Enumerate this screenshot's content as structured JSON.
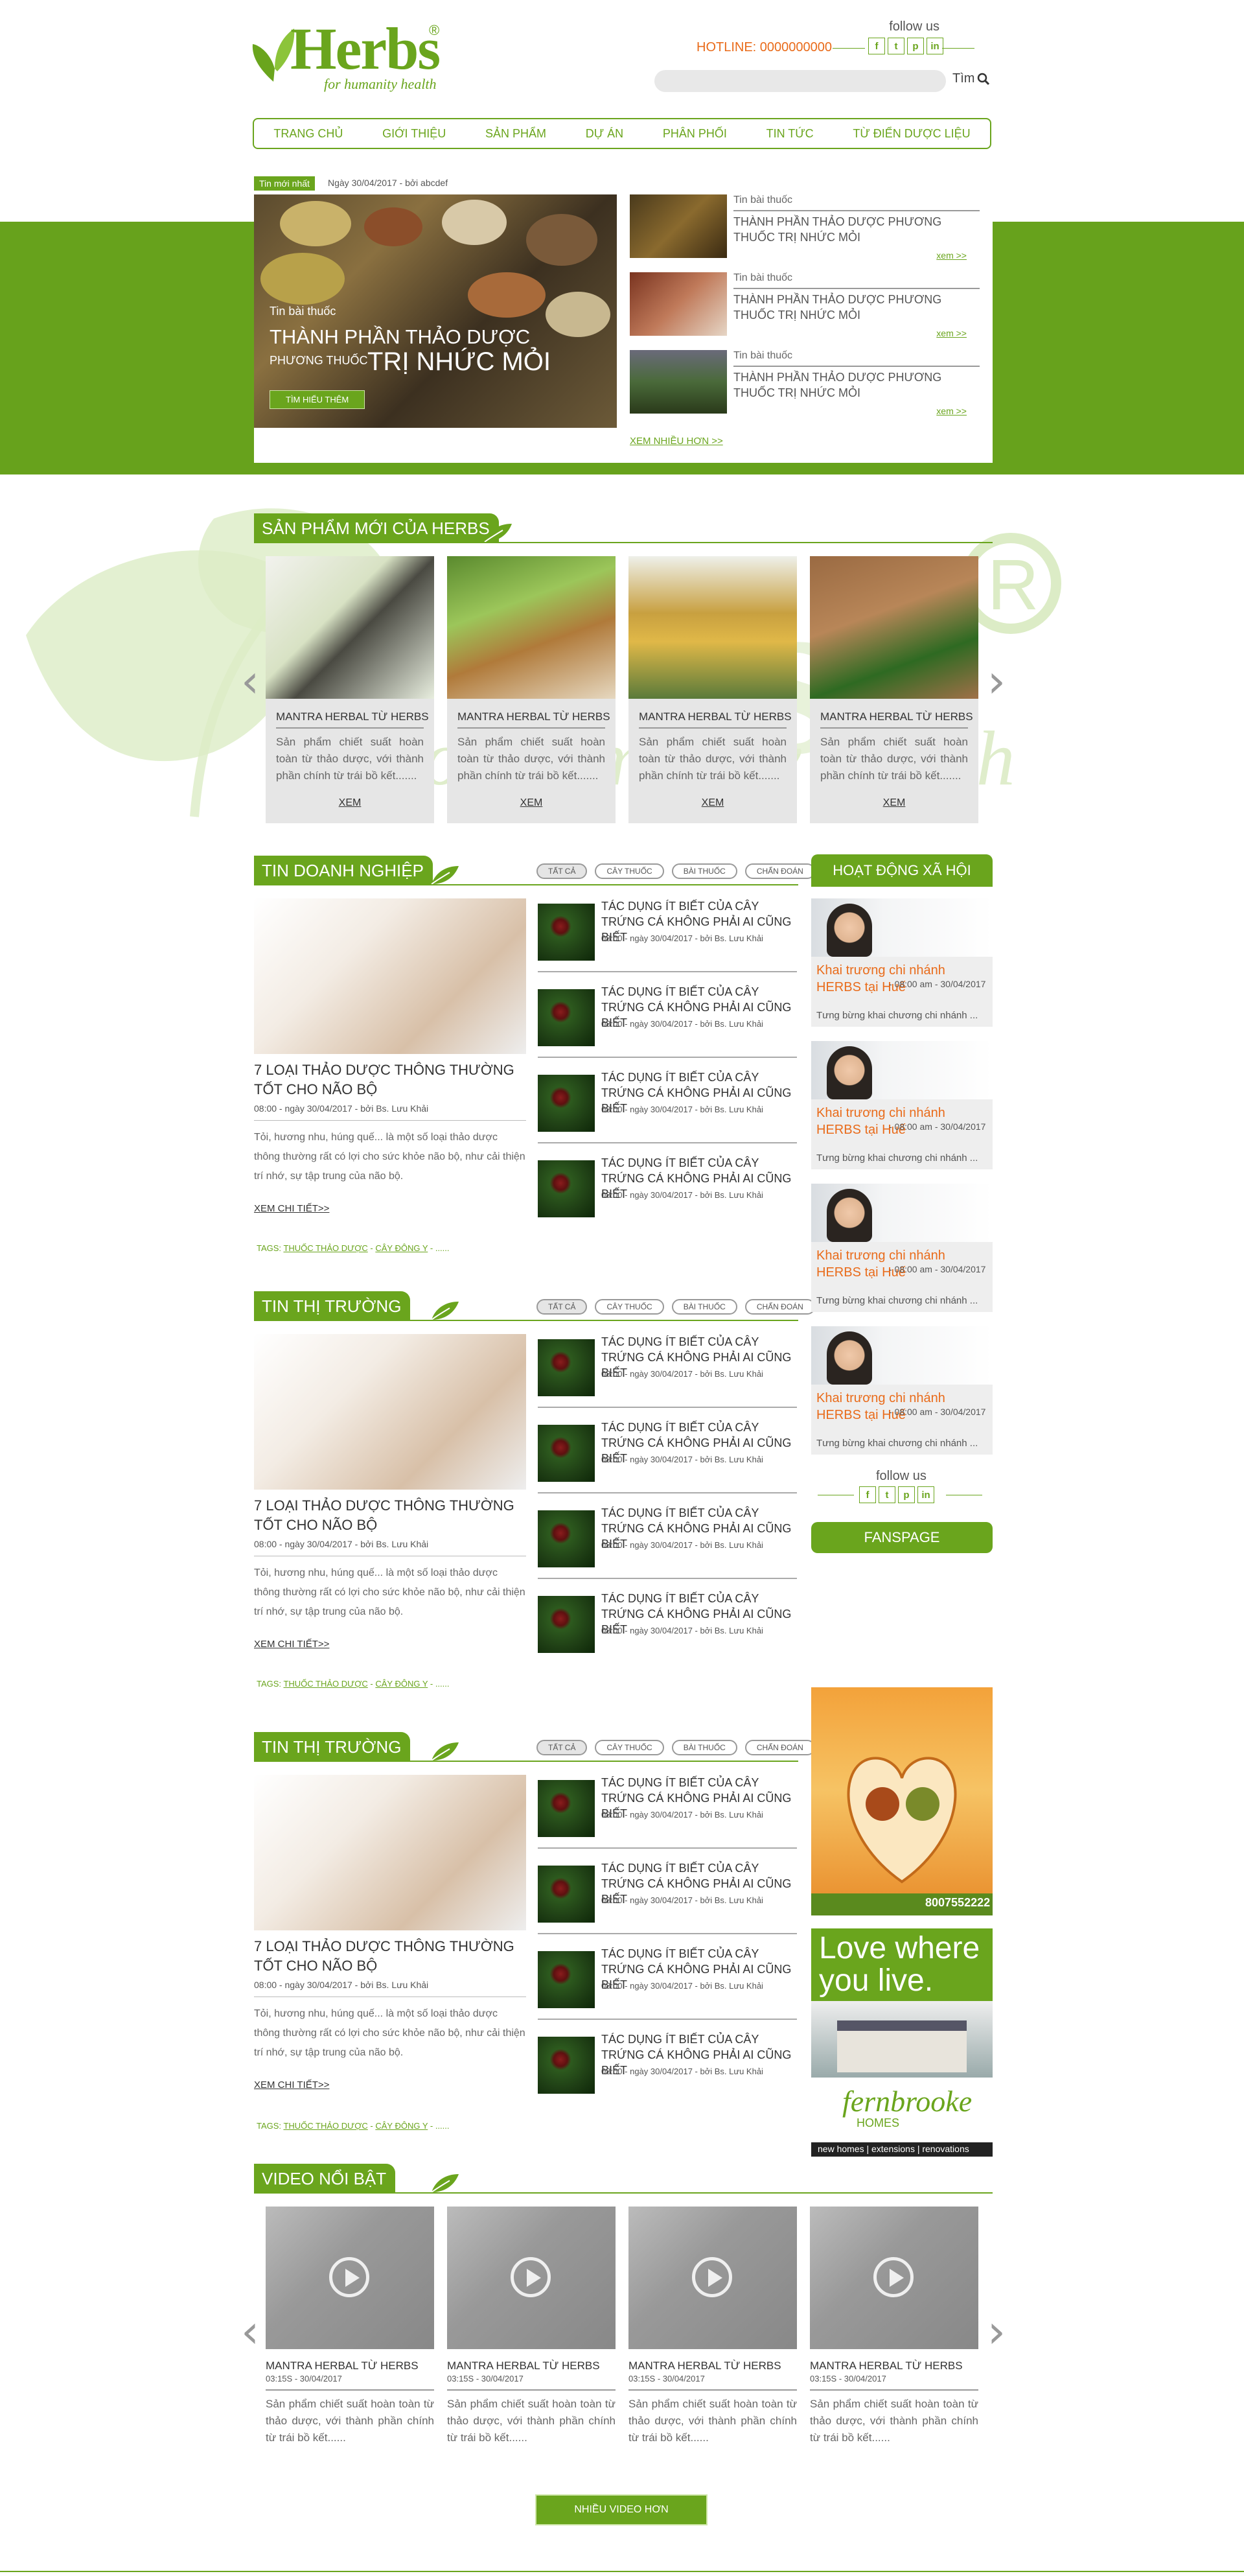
{
  "header": {
    "logo_text": "Herbs",
    "logo_tagline": "for humanity health",
    "logo_reg": "®",
    "follow_us": "follow us",
    "hotline": "HOTLINE: 0000000000",
    "search_placeholder": "",
    "search_button": "Tìm",
    "social": [
      "f",
      "t",
      "p",
      "in"
    ]
  },
  "nav": [
    "TRANG CHỦ",
    "GIỚI THIỆU",
    "SẢN PHẨM",
    "DỰ ÁN",
    "PHÂN PHỐI",
    "TIN TỨC",
    "TỪ ĐIỂN DƯỢC LIỆU"
  ],
  "hero": {
    "badge": "Tin mới nhất",
    "date": "Ngày 30/04/2017 - bởi abcdef",
    "category": "Tin bài thuốc",
    "title": "THÀNH PHẦN THẢO DƯỢC",
    "subtitle_small": "PHƯƠNG THUỐC",
    "subtitle_big": "TRỊ NHỨC MỎI",
    "button": "TÌM HIỂU THÊM",
    "side_news": [
      {
        "category": "Tin bài thuốc",
        "title": "THÀNH PHẦN THẢO DƯỢC PHƯƠNG THUỐC TRỊ NHỨC MỎI",
        "more": "xem >>"
      },
      {
        "category": "Tin bài thuốc",
        "title": "THÀNH PHẦN THẢO DƯỢC PHƯƠNG THUỐC TRỊ NHỨC MỎI",
        "more": "xem >>"
      },
      {
        "category": "Tin bài thuốc",
        "title": "THÀNH PHẦN THẢO DƯỢC PHƯƠNG THUỐC TRỊ NHỨC MỎI",
        "more": "xem >>"
      }
    ],
    "more_news": "XEM NHIỀU HƠN >>"
  },
  "products": {
    "heading": "SẢN PHẨM MỚI CỦA HERBS",
    "items": [
      {
        "title": "MANTRA HERBAL TỪ HERBS",
        "desc": "Sản phẩm chiết suất hoàn toàn từ thảo dược, với thành phần chính từ trái bồ kết.......",
        "more": "XEM"
      },
      {
        "title": "MANTRA HERBAL TỪ HERBS",
        "desc": "Sản phẩm chiết suất hoàn toàn từ thảo dược, với thành phần chính từ trái bồ kết.......",
        "more": "XEM"
      },
      {
        "title": "MANTRA HERBAL TỪ HERBS",
        "desc": "Sản phẩm chiết suất hoàn toàn từ thảo dược, với thành phần chính từ trái bồ kết.......",
        "more": "XEM"
      },
      {
        "title": "MANTRA HERBAL TỪ HERBS",
        "desc": "Sản phẩm chiết suất hoàn toàn từ thảo dược, với thành phần chính từ trái bồ kết.......",
        "more": "XEM"
      }
    ]
  },
  "filters": [
    "TẤT CẢ",
    "CÂY THUỐC",
    "BÀI THUỐC",
    "CHẨN ĐOÁN"
  ],
  "news_sections": [
    {
      "heading": "TIN DOANH NGHIỆP",
      "big_title": "7 LOẠI THẢO DƯỢC THÔNG THƯỜNG TỐT CHO NÃO BỘ",
      "big_meta": "08:00 - ngày 30/04/2017 - bởi Bs. Lưu Khải",
      "big_desc": "Tỏi, hương nhu, húng quế... là một số loại thảo dược thông thường rất có lợi cho sức khỏe não bộ, như cải thiện trí nhớ, sự tập trung của não bộ.",
      "big_more": "XEM CHI TIẾT>>",
      "tags_label": "TAGS:",
      "tag1": "THUỐC THẢO DƯỢC",
      "tag2": "CÂY ĐÔNG Y",
      "tags_end": "- ......",
      "items": [
        {
          "title": "TÁC DỤNG ÍT BIẾT CỦA CÂY TRỨNG CÁ KHÔNG PHẢI AI CŨNG BIẾT",
          "meta": "08:00 - ngày 30/04/2017 - bởi Bs. Lưu Khải"
        },
        {
          "title": "TÁC DỤNG ÍT BIẾT CỦA CÂY TRỨNG CÁ KHÔNG PHẢI AI CŨNG BIẾT",
          "meta": "08:00 - ngày 30/04/2017 - bởi Bs. Lưu Khải"
        },
        {
          "title": "TÁC DỤNG ÍT BIẾT CỦA CÂY TRỨNG CÁ KHÔNG PHẢI AI CŨNG BIẾT",
          "meta": "08:00 - ngày 30/04/2017 - bởi Bs. Lưu Khải"
        },
        {
          "title": "TÁC DỤNG ÍT BIẾT CỦA CÂY TRỨNG CÁ KHÔNG PHẢI AI CŨNG BIẾT",
          "meta": "08:00 - ngày 30/04/2017 - bởi Bs. Lưu Khải"
        }
      ]
    },
    {
      "heading": "TIN THỊ TRƯỜNG",
      "big_title": "7 LOẠI THẢO DƯỢC THÔNG THƯỜNG TỐT CHO NÃO BỘ",
      "big_meta": "08:00 - ngày 30/04/2017 - bởi Bs. Lưu Khải",
      "big_desc": "Tỏi, hương nhu, húng quế... là một số loại thảo dược thông thường rất có lợi cho sức khỏe não bộ, như cải thiện trí nhớ, sự tập trung của não bộ.",
      "big_more": "XEM CHI TIẾT>>",
      "tags_label": "TAGS:",
      "tag1": "THUỐC THẢO DƯỢC",
      "tag2": "CÂY ĐÔNG Y",
      "tags_end": "- ......",
      "items": [
        {
          "title": "TÁC DỤNG ÍT BIẾT CỦA CÂY TRỨNG CÁ KHÔNG PHẢI AI CŨNG BIẾT",
          "meta": "08:00 - ngày 30/04/2017 - bởi Bs. Lưu Khải"
        },
        {
          "title": "TÁC DỤNG ÍT BIẾT CỦA CÂY TRỨNG CÁ KHÔNG PHẢI AI CŨNG BIẾT",
          "meta": "08:00 - ngày 30/04/2017 - bởi Bs. Lưu Khải"
        },
        {
          "title": "TÁC DỤNG ÍT BIẾT CỦA CÂY TRỨNG CÁ KHÔNG PHẢI AI CŨNG BIẾT",
          "meta": "08:00 - ngày 30/04/2017 - bởi Bs. Lưu Khải"
        },
        {
          "title": "TÁC DỤNG ÍT BIẾT CỦA CÂY TRỨNG CÁ KHÔNG PHẢI AI CŨNG BIẾT",
          "meta": "08:00 - ngày 30/04/2017 - bởi Bs. Lưu Khải"
        }
      ]
    },
    {
      "heading": "TIN THỊ TRƯỜNG",
      "big_title": "7 LOẠI THẢO DƯỢC THÔNG THƯỜNG TỐT CHO NÃO BỘ",
      "big_meta": "08:00 - ngày 30/04/2017 - bởi Bs. Lưu Khải",
      "big_desc": "Tỏi, hương nhu, húng quế... là một số loại thảo dược thông thường rất có lợi cho sức khỏe não bộ, như cải thiện trí nhớ, sự tập trung của não bộ.",
      "big_more": "XEM CHI TIẾT>>",
      "tags_label": "TAGS:",
      "tag1": "THUỐC THẢO DƯỢC",
      "tag2": "CÂY ĐÔNG Y",
      "tags_end": "- ......",
      "items": [
        {
          "title": "TÁC DỤNG ÍT BIẾT CỦA CÂY TRỨNG CÁ KHÔNG PHẢI AI CŨNG BIẾT",
          "meta": "08:00 - ngày 30/04/2017 - bởi Bs. Lưu Khải"
        },
        {
          "title": "TÁC DỤNG ÍT BIẾT CỦA CÂY TRỨNG CÁ KHÔNG PHẢI AI CŨNG BIẾT",
          "meta": "08:00 - ngày 30/04/2017 - bởi Bs. Lưu Khải"
        },
        {
          "title": "TÁC DỤNG ÍT BIẾT CỦA CÂY TRỨNG CÁ KHÔNG PHẢI AI CŨNG BIẾT",
          "meta": "08:00 - ngày 30/04/2017 - bởi Bs. Lưu Khải"
        },
        {
          "title": "TÁC DỤNG ÍT BIẾT CỦA CÂY TRỨNG CÁ KHÔNG PHẢI AI CŨNG BIẾT",
          "meta": "08:00 - ngày 30/04/2017 - bởi Bs. Lưu Khải"
        }
      ]
    }
  ],
  "activities": {
    "heading": "HOẠT ĐỘNG XÃ HỘI",
    "items": [
      {
        "title": "Khai trương chi nhánh HERBS tại Huế",
        "meta": "- 08:00 am - 30/04/2017",
        "desc": "Tưng bừng khai chương chi nhánh ..."
      },
      {
        "title": "Khai trương chi nhánh HERBS tại Huế",
        "meta": "- 08:00 am - 30/04/2017",
        "desc": "Tưng bừng khai chương chi nhánh ..."
      },
      {
        "title": "Khai trương chi nhánh HERBS tại Huế",
        "meta": "- 08:00 am - 30/04/2017",
        "desc": "Tưng bừng khai chương chi nhánh ..."
      },
      {
        "title": "Khai trương chi nhánh HERBS tại Huế",
        "meta": "- 08:00 am - 30/04/2017",
        "desc": "Tưng bừng khai chương chi nhánh ..."
      }
    ],
    "follow_us": "follow us",
    "fanpage": "FANSPAGE"
  },
  "ads": {
    "ad1_phone": "8007552222",
    "ad2_headline": "Love where you live.",
    "ad2_brand": "fernbrooke",
    "ad2_brand2": "HOMES",
    "ad2_footer": "new homes | extensions | renovations"
  },
  "videos": {
    "heading": "VIDEO NỔI BẬT",
    "items": [
      {
        "title": "MANTRA HERBAL TỪ HERBS",
        "meta": "03:15S - 30/04/2017",
        "desc": "Sản phẩm chiết suất hoàn toàn từ thảo dược, với thành phần chính từ trái bồ kết......"
      },
      {
        "title": "MANTRA HERBAL TỪ HERBS",
        "meta": "03:15S - 30/04/2017",
        "desc": "Sản phẩm chiết suất hoàn toàn từ thảo dược, với thành phần chính từ trái bồ kết......"
      },
      {
        "title": "MANTRA HERBAL TỪ HERBS",
        "meta": "03:15S - 30/04/2017",
        "desc": "Sản phẩm chiết suất hoàn toàn từ thảo dược, với thành phần chính từ trái bồ kết......"
      },
      {
        "title": "MANTRA HERBAL TỪ HERBS",
        "meta": "03:15S - 30/04/2017",
        "desc": "Sản phẩm chiết suất hoàn toàn từ thảo dược, với thành phần chính từ trái bồ kết......"
      }
    ],
    "more": "NHIỀU VIDEO HƠN"
  },
  "colors": {
    "brand": "#6aa51d",
    "accent": "#e96b1a"
  },
  "icons": [
    "leaf-logo-icon",
    "search-icon",
    "facebook-icon",
    "twitter-icon",
    "pinterest-icon",
    "linkedin-icon",
    "chevron-left-icon",
    "chevron-right-icon",
    "play-icon",
    "leaf-icon"
  ]
}
